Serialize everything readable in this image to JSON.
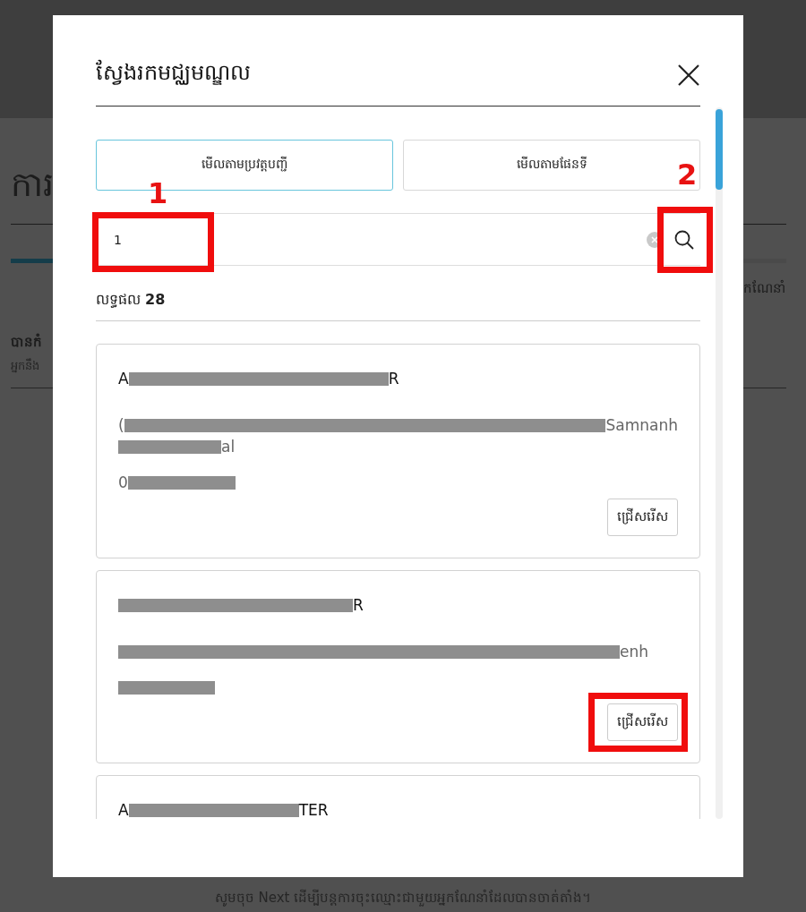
{
  "background_page": {
    "heading": "ការ",
    "note_right": "កណែនាំ",
    "section_title": "បានកំ",
    "section_text": "អ្នកនឹង",
    "footer_text": "សូមចុច Next ដើម្បីបន្តការចុះឈ្មោះជាមួយអ្នកណែនាំដែលបានចាត់តាំង។",
    "progress": {
      "level": 0.06
    }
  },
  "dialog": {
    "title": "ស្វែងរកមជ្ឈមណ្ឌល",
    "tabs": [
      {
        "label": "មើលតាមប្រវត្តបញ្ជី",
        "selected": true
      },
      {
        "label": "មើលតាមផែនទី",
        "selected": false
      }
    ],
    "search": {
      "value": "1",
      "value_highlighted": true,
      "value_number": "1",
      "button_highlighted": true,
      "button_number": "2"
    },
    "results_label": "លទ្ធផល",
    "results_count": "28",
    "centers": [
      {
        "name": [
          {
            "kind": "text",
            "text": "A"
          },
          {
            "kind": "redacted"
          },
          {
            "kind": "text",
            "text": "R"
          }
        ],
        "address": [
          [
            {
              "kind": "text",
              "text": "("
            },
            {
              "kind": "redacted"
            },
            {
              "kind": "text",
              "text": "Samnanh"
            }
          ],
          [
            {
              "kind": "redacted"
            },
            {
              "kind": "text",
              "text": "al"
            }
          ]
        ],
        "phone": [
          {
            "kind": "text",
            "text": "0"
          },
          {
            "kind": "redacted"
          }
        ],
        "button": "ជ្រើសរើស",
        "button_highlighted": false
      },
      {
        "name": [
          {
            "kind": "redacted"
          },
          {
            "kind": "text",
            "text": "R"
          }
        ],
        "address": [
          [
            {
              "kind": "redacted"
            },
            {
              "kind": "text",
              "text": "enh"
            }
          ]
        ],
        "phone": [
          {
            "kind": "redacted"
          }
        ],
        "button": "ជ្រើសរើស",
        "button_highlighted": true
      },
      {
        "name": [
          {
            "kind": "text",
            "text": "A"
          },
          {
            "kind": "redacted"
          },
          {
            "kind": "text",
            "text": "TER"
          }
        ]
      }
    ]
  }
}
